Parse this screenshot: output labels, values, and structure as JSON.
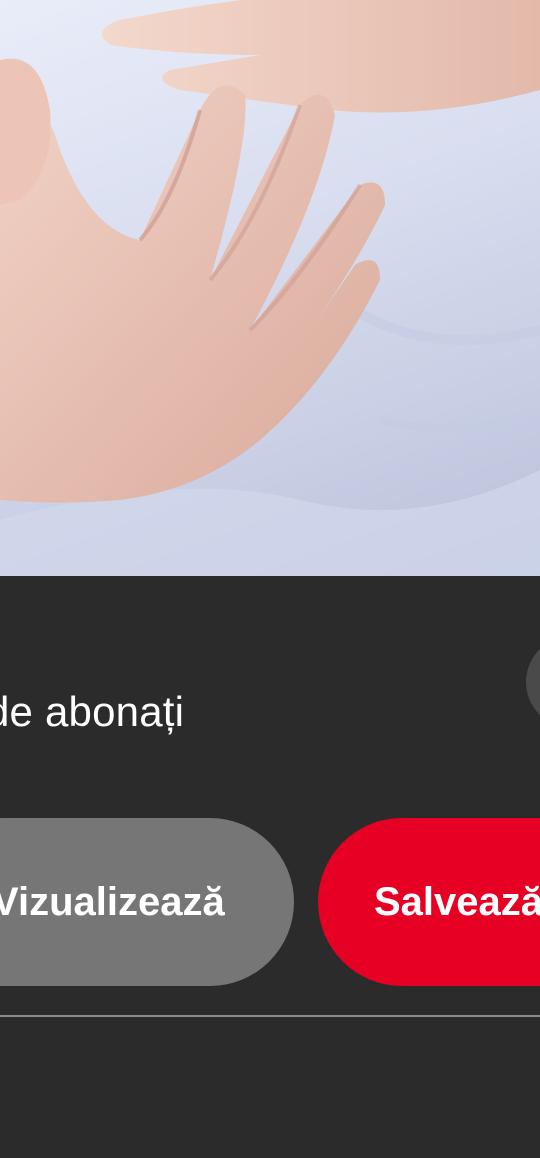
{
  "profile": {
    "followers_suffix": "de abonați"
  },
  "actions": {
    "preview_label": "Vizualizează",
    "save_label": "Salvează"
  },
  "colors": {
    "panel_background": "#2b2b2c",
    "save_button": "#e60023",
    "preview_button": "#767676",
    "text": "#ffffff"
  },
  "icons": {
    "side_control": "circle-button-icon"
  }
}
